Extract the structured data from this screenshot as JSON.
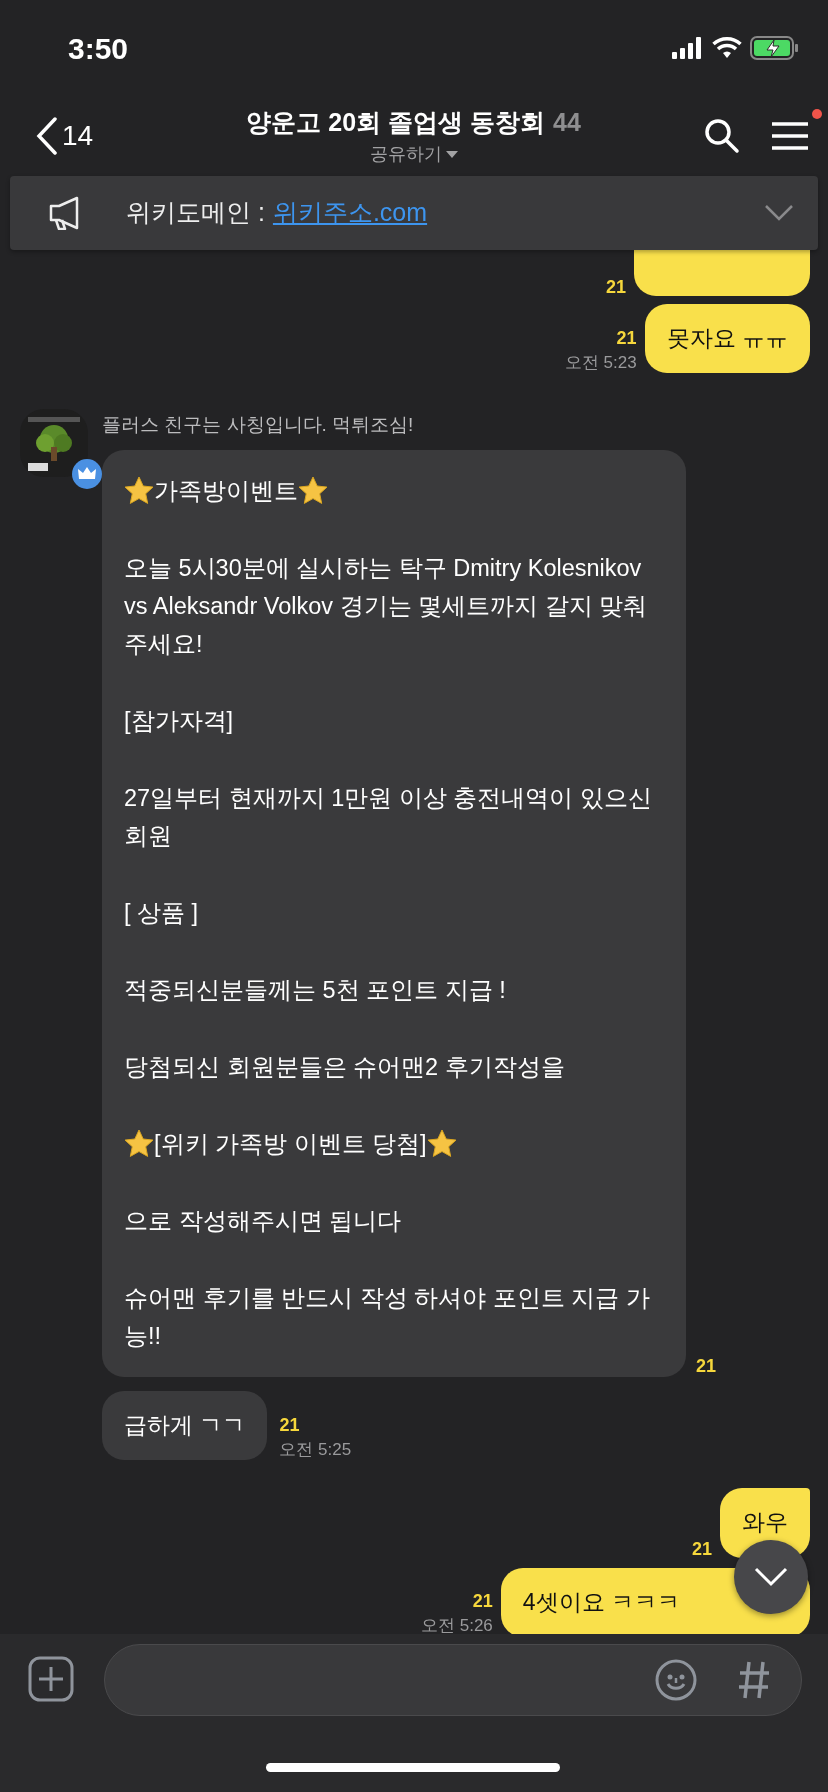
{
  "status_bar": {
    "time": "3:50"
  },
  "header": {
    "back_count": "14",
    "title": "양운고 20회 졸업생 동창회",
    "member_count": "44",
    "subtitle": "공유하기",
    "menu_badge": true
  },
  "notice": {
    "label": "위키도메인 :",
    "link": "위키주소.com"
  },
  "messages": [
    {
      "kind": "mine-partial",
      "unread": "21"
    },
    {
      "kind": "mine",
      "text": "못자요 ㅠㅠ",
      "unread": "21",
      "time": "오전 5:23"
    },
    {
      "kind": "theirs-long",
      "sender": "플러스 친구는 사칭입니다. 먹튀조심!",
      "unread": "21",
      "lines": [
        {
          "text": "가족방이벤트",
          "starred": true
        },
        {
          "text": "오늘 5시30분에 실시하는 탁구 Dmitry Kolesnikov vs Aleksandr Volkov 경기는 몇세트까지 갈지 맞춰주세요!",
          "starred": false
        },
        {
          "text": "[참가자격]",
          "starred": false
        },
        {
          "text": "27일부터 현재까지 1만원 이상 충전내역이 있으신 회원",
          "starred": false
        },
        {
          "text": "[ 상품 ]",
          "starred": false
        },
        {
          "text": "적중되신분들께는 5천 포인트 지급 !",
          "starred": false
        },
        {
          "text": "당첨되신 회원분들은 슈어맨2 후기작성을",
          "starred": false
        },
        {
          "text": "[위키 가족방 이벤트 당첨]",
          "starred": true
        },
        {
          "text": "으로 작성해주시면 됩니다",
          "starred": false
        },
        {
          "text": "슈어맨 후기를 반드시 작성 하셔야 포인트 지급 가능!!",
          "starred": false
        }
      ]
    },
    {
      "kind": "theirs",
      "text": "급하게 ㄱㄱ",
      "unread": "21",
      "time": "오전 5:25"
    },
    {
      "kind": "mine",
      "text": "와우",
      "unread": "21",
      "tail": true
    },
    {
      "kind": "mine",
      "text": "4셋이요 ㅋㅋㅋ",
      "unread": "21",
      "time": "오전 5:26"
    }
  ]
}
